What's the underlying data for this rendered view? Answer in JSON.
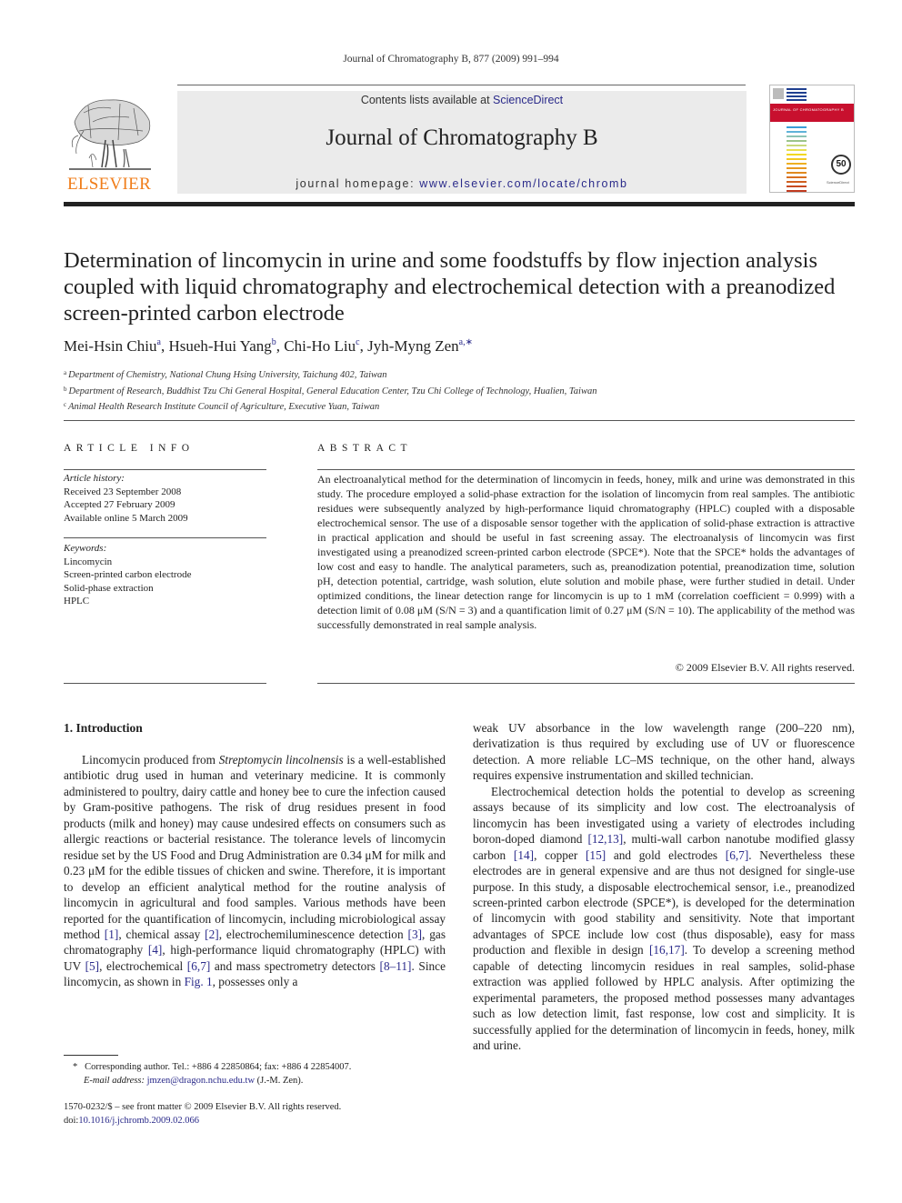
{
  "running_head": "Journal of Chromatography B, 877 (2009) 991–994",
  "masthead": {
    "contents_prefix": "Contents lists available at ",
    "contents_link": "ScienceDirect",
    "journal_title": "Journal of Chromatography B",
    "homepage_prefix": "journal homepage: ",
    "homepage_link": "www.elsevier.com/locate/chromb",
    "publisher_logo_text": "ELSEVIER",
    "cover_band_text": "JOURNAL OF CHROMATOGRAPHY B",
    "cover_seal_text": "50",
    "colors": {
      "elsevier_orange": "#f07d1a",
      "link_blue": "#2a2a8a",
      "cover_red": "#c8102e",
      "masthead_gray": "#ebebeb"
    }
  },
  "article": {
    "title": "Determination of lincomycin in urine and some foodstuffs by flow injection analysis coupled with liquid chromatography and electrochemical detection with a preanodized screen-printed carbon electrode",
    "authors": [
      {
        "name": "Mei-Hsin Chiu",
        "sup": "a"
      },
      {
        "name": "Hsueh-Hui Yang",
        "sup": "b"
      },
      {
        "name": "Chi-Ho Liu",
        "sup": "c"
      },
      {
        "name": "Jyh-Myng Zen",
        "sup": "a,∗"
      }
    ],
    "affiliations": [
      {
        "sup": "a",
        "text": "Department of Chemistry, National Chung Hsing University, Taichung 402, Taiwan"
      },
      {
        "sup": "b",
        "text": "Department of Research, Buddhist Tzu Chi General Hospital, General Education Center, Tzu Chi College of Technology, Hualien, Taiwan"
      },
      {
        "sup": "c",
        "text": "Animal Health Research Institute Council of Agriculture, Executive Yuan, Taiwan"
      }
    ]
  },
  "article_info": {
    "heading": "ARTICLE INFO",
    "history_label": "Article history:",
    "history": [
      "Received 23 September 2008",
      "Accepted 27 February 2009",
      "Available online 5 March 2009"
    ],
    "keywords_label": "Keywords:",
    "keywords": [
      "Lincomycin",
      "Screen-printed carbon electrode",
      "Solid-phase extraction",
      "HPLC"
    ]
  },
  "abstract": {
    "heading": "ABSTRACT",
    "text": "An electroanalytical method for the determination of lincomycin in feeds, honey, milk and urine was demonstrated in this study. The procedure employed a solid-phase extraction for the isolation of lincomycin from real samples. The antibiotic residues were subsequently analyzed by high-performance liquid chromatography (HPLC) coupled with a disposable electrochemical sensor. The use of a disposable sensor together with the application of solid-phase extraction is attractive in practical application and should be useful in fast screening assay. The electroanalysis of lincomycin was first investigated using a preanodized screen-printed carbon electrode (SPCE*). Note that the SPCE* holds the advantages of low cost and easy to handle. The analytical parameters, such as, preanodization potential, preanodization time, solution pH, detection potential, cartridge, wash solution, elute solution and mobile phase, were further studied in detail. Under optimized conditions, the linear detection range for lincomycin is up to 1 mM (correlation coefficient = 0.999) with a detection limit of 0.08 μM (S/N = 3) and a quantification limit of 0.27 μM (S/N = 10). The applicability of the method was successfully demonstrated in real sample analysis.",
    "copyright": "© 2009 Elsevier B.V. All rights reserved."
  },
  "introduction": {
    "heading": "1.  Introduction",
    "p1": {
      "t1": "Lincomycin produced from ",
      "species": "Streptomycin lincolnensis",
      "t2": " is a well-established antibiotic drug used in human and veterinary medicine. It is commonly administered to poultry, dairy cattle and honey bee to cure the infection caused by Gram-positive pathogens. The risk of drug residues present in food products (milk and honey) may cause undesired effects on consumers such as allergic reactions or bacterial resistance. The tolerance levels of lincomycin residue set by the US Food and Drug Administration are 0.34 μM for milk and 0.23 μM for the edible tissues of chicken and swine. Therefore, it is important to develop an efficient analytical method for the routine analysis of lincomycin in agricultural and food samples. Various methods have been reported for the quantification of lincomycin, including microbiological assay method ",
      "r1": "[1]",
      "t3": ", chemical assay ",
      "r2": "[2]",
      "t4": ", electrochemiluminescence detection ",
      "r3": "[3]",
      "t5": ", gas chromatography ",
      "r4": "[4]",
      "t6": ", high-performance liquid chromatography (HPLC) with UV ",
      "r5": "[5]",
      "t7": ", electrochemical ",
      "r6": "[6,7]",
      "t8": " and mass spectrometry detectors ",
      "r7": "[8–11]",
      "t9": ". Since lincomycin, as shown in ",
      "fig": "Fig. 1",
      "t10": ", possesses only a"
    },
    "p1_cont": "weak UV absorbance in the low wavelength range (200–220 nm), derivatization is thus required by excluding use of UV or fluorescence detection. A more reliable LC–MS technique, on the other hand, always requires expensive instrumentation and skilled technician.",
    "p2": {
      "t1": "Electrochemical detection holds the potential to develop as screening assays because of its simplicity and low cost. The electroanalysis of lincomycin has been investigated using a variety of electrodes including boron-doped diamond ",
      "r1": "[12,13]",
      "t2": ", multi-wall carbon nanotube modified glassy carbon ",
      "r2": "[14]",
      "t3": ", copper ",
      "r3": "[15]",
      "t4": " and gold electrodes ",
      "r4": "[6,7]",
      "t5": ". Nevertheless these electrodes are in general expensive and are thus not designed for single-use purpose. In this study, a disposable electrochemical sensor, i.e., preanodized screen-printed carbon electrode (SPCE*), is developed for the determination of lincomycin with good stability and sensitivity. Note that important advantages of SPCE include low cost (thus disposable), easy for mass production and flexible in design ",
      "r5": "[16,17]",
      "t6": ". To develop a screening method capable of detecting lincomycin residues in real samples, solid-phase extraction was applied followed by HPLC analysis. After optimizing the experimental parameters, the proposed method possesses many advantages such as low detection limit, fast response, low cost and simplicity. It is successfully applied for the determination of lincomycin in feeds, honey, milk and urine."
    }
  },
  "footnotes": {
    "corresponding_mark": "*",
    "corresponding": "Corresponding author. Tel.: +886 4 22850864; fax: +886 4 22854007.",
    "email_label": "E-mail address:",
    "email": "jmzen@dragon.nchu.edu.tw",
    "email_suffix": " (J.-M. Zen).",
    "issn_line": "1570-0232/$ – see front matter © 2009 Elsevier B.V. All rights reserved.",
    "doi_prefix": "doi:",
    "doi": "10.1016/j.jchromb.2009.02.066"
  }
}
